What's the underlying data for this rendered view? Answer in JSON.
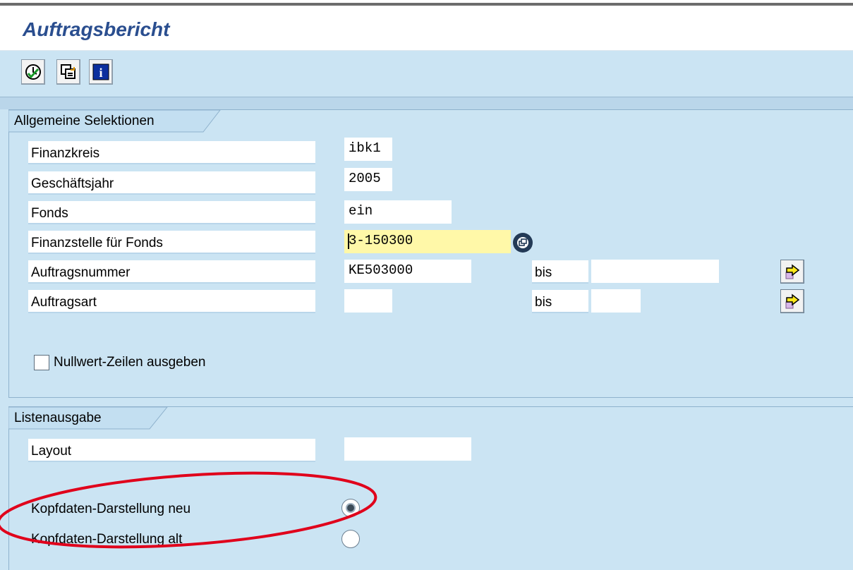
{
  "window": {
    "title": "Auftragsbericht"
  },
  "toolbar": {
    "buttons": [
      {
        "icon": "execute-clock-icon",
        "label": ""
      },
      {
        "icon": "copy-variant-icon",
        "label": ""
      },
      {
        "icon": "info-icon",
        "label": "i"
      }
    ]
  },
  "general_selections": {
    "group_title": "Allgemeine Selektionen",
    "fields": [
      {
        "label": "Finanzkreis",
        "value": "ibk1"
      },
      {
        "label": "Geschäftsjahr",
        "value": "2005"
      },
      {
        "label": "Fonds",
        "value": "ein"
      },
      {
        "label": "Finanzstelle für Fonds",
        "value": "3-150300",
        "required": true
      },
      {
        "label": "Auftragsnummer",
        "value": "KE503000",
        "to_label": "bis",
        "to_value": ""
      },
      {
        "label": "Auftragsart",
        "value": "",
        "to_label": "bis",
        "to_value": ""
      }
    ],
    "checkbox": {
      "label": "Nullwert-Zeilen ausgeben",
      "checked": false
    }
  },
  "list_output": {
    "group_title": "Listenausgabe",
    "layout": {
      "label": "Layout",
      "value": ""
    },
    "radios": [
      {
        "label": "Kopfdaten-Darstellung neu",
        "selected": true
      },
      {
        "label": "Kopfdaten-Darstellung alt",
        "selected": false
      }
    ]
  },
  "colors": {
    "background": "#cbe4f3",
    "title": "#2a4e8f",
    "required_field": "#fff8a8",
    "annotation": "#e0001b"
  }
}
